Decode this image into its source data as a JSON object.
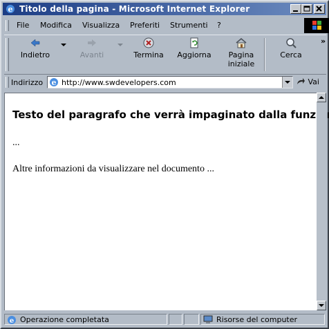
{
  "window": {
    "title": "Titolo della pagina - Microsoft Internet Explorer"
  },
  "menu": {
    "items": [
      {
        "label": "File"
      },
      {
        "label": "Modifica"
      },
      {
        "label": "Visualizza"
      },
      {
        "label": "Preferiti"
      },
      {
        "label": "Strumenti"
      },
      {
        "label": "?"
      }
    ]
  },
  "toolbar": {
    "back": {
      "label": "Indietro",
      "enabled": true,
      "icon": "back-arrow-icon"
    },
    "forward": {
      "label": "Avanti",
      "enabled": false,
      "icon": "forward-arrow-icon"
    },
    "stop": {
      "label": "Termina",
      "icon": "stop-icon"
    },
    "refresh": {
      "label": "Aggiorna",
      "icon": "refresh-icon"
    },
    "home": {
      "label_line1": "Pagina",
      "label_line2": "iniziale",
      "icon": "home-icon"
    },
    "search": {
      "label": "Cerca",
      "icon": "search-icon"
    },
    "overflow": "»"
  },
  "address": {
    "label": "Indirizzo",
    "url": "http://www.swdevelopers.com",
    "go_label": "Vai"
  },
  "page": {
    "heading": "Testo del paragrafo che verrà impaginato dalla funzione",
    "ellipsis": "...",
    "paragraph": "Altre informazioni da visualizzare nel documento ..."
  },
  "status": {
    "text": "Operazione completata",
    "zone": "Risorse del computer"
  },
  "colors": {
    "titlebar_start": "#1c3d85",
    "titlebar_end": "#6d8cc0",
    "chrome": "#b3bcc7"
  }
}
